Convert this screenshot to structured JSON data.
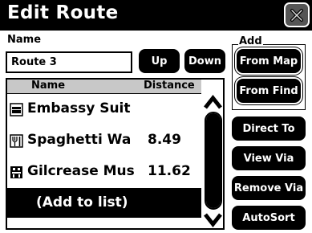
{
  "window": {
    "title": "Edit Route",
    "close_icon": "close-x-icon"
  },
  "name_field": {
    "label": "Name",
    "value": "Route 3"
  },
  "reorder": {
    "up_label": "Up",
    "down_label": "Down"
  },
  "add_group": {
    "label": "Add",
    "from_map_label": "From Map",
    "from_find_label": "From Find"
  },
  "list": {
    "columns": {
      "name": "Name",
      "distance": "Distance"
    },
    "rows": [
      {
        "icon": "lodging-icon",
        "name": "Embassy Suit",
        "distance": ""
      },
      {
        "icon": "dining-icon",
        "name": "Spaghetti Wa",
        "distance": "8.49"
      },
      {
        "icon": "attraction-icon",
        "name": "Gilcrease Mus",
        "distance": "11.62"
      }
    ],
    "add_item_label": "(Add to list)"
  },
  "actions": {
    "direct_to_label": "Direct To",
    "view_via_label": "View Via",
    "remove_via_label": "Remove Via",
    "autosort_label": "AutoSort"
  }
}
